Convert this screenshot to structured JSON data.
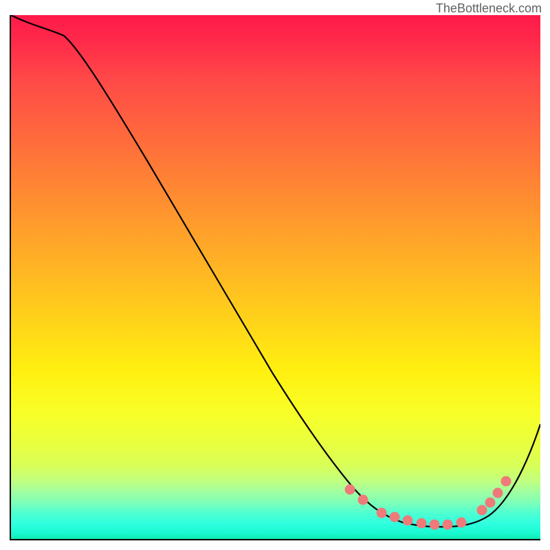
{
  "attribution": "TheBottleneck.com",
  "chart_data": {
    "type": "line",
    "title": "",
    "xlabel": "",
    "ylabel": "",
    "xlim": [
      0,
      100
    ],
    "ylim": [
      0,
      100
    ],
    "series": [
      {
        "name": "bottleneck-curve",
        "x": [
          0,
          6,
          10,
          20,
          30,
          40,
          50,
          60,
          65,
          70,
          75,
          78,
          82,
          86,
          90,
          95,
          100
        ],
        "y": [
          100,
          98,
          96,
          80,
          63,
          47,
          30,
          15,
          9,
          5,
          3,
          2.5,
          2.5,
          3,
          5,
          12,
          22
        ]
      }
    ],
    "markers": {
      "name": "marker-dots",
      "color": "#f08080",
      "x": [
        64,
        66.5,
        70,
        72.5,
        75,
        77.5,
        80,
        82.5,
        85,
        89,
        90.5,
        92,
        93.5
      ],
      "y": [
        9.5,
        7.5,
        5,
        4.2,
        3.5,
        3,
        2.8,
        2.8,
        3.2,
        5.5,
        7,
        8.8,
        11
      ]
    },
    "gradient_stops": [
      {
        "pct": 0,
        "color": "#ff1a4a"
      },
      {
        "pct": 50,
        "color": "#ffc020"
      },
      {
        "pct": 76,
        "color": "#f8ff28"
      },
      {
        "pct": 93,
        "color": "#80ffb8"
      },
      {
        "pct": 100,
        "color": "#10e8b0"
      }
    ]
  }
}
